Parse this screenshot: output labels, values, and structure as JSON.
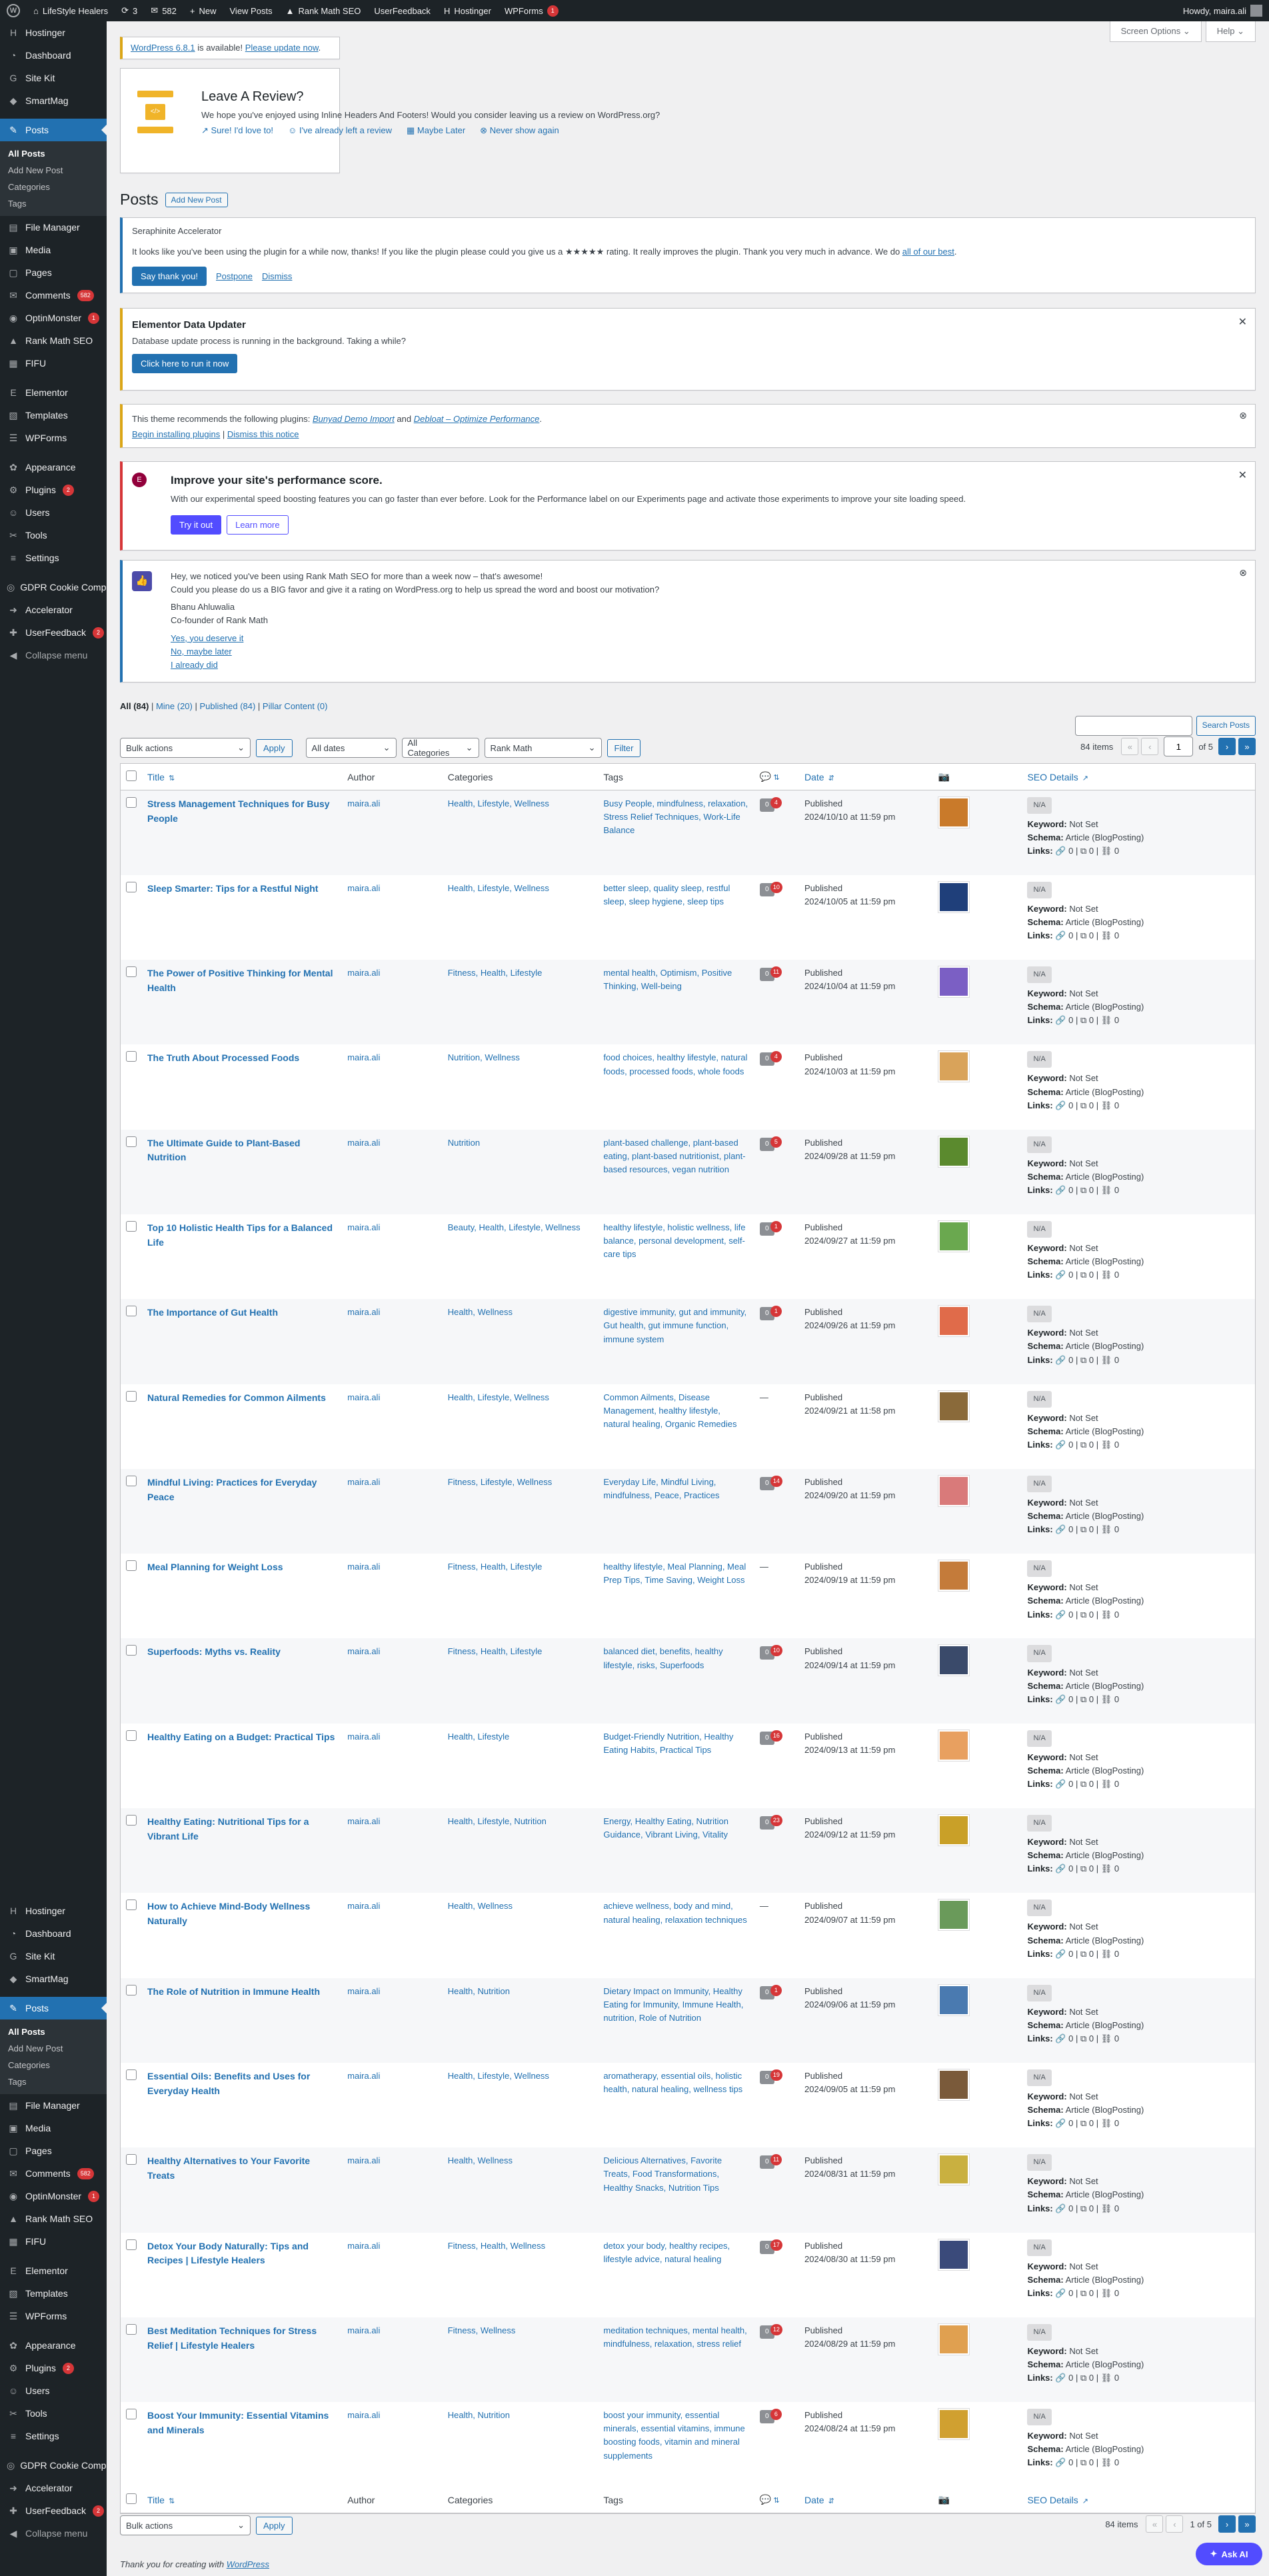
{
  "adminbar": {
    "site": "LifeStyle Healers",
    "updates": "3",
    "comments": "582",
    "new": "New",
    "view": "View Posts",
    "rank": "Rank Math SEO",
    "uf": "UserFeedback",
    "host": "Hostinger",
    "wpforms": "WPForms",
    "wpforms_count": "1",
    "howdy": "Howdy, maira.ali"
  },
  "menu": [
    {
      "id": "hostinger",
      "label": "Hostinger",
      "icon": "H"
    },
    {
      "id": "dashboard",
      "label": "Dashboard",
      "icon": "◔"
    },
    {
      "id": "sitekit",
      "label": "Site Kit",
      "icon": "G"
    },
    {
      "id": "smartmag",
      "label": "SmartMag",
      "icon": "◆"
    },
    {
      "id": "posts",
      "label": "Posts",
      "icon": "✎",
      "active": true
    },
    {
      "id": "filemanager",
      "label": "File Manager",
      "icon": "▤"
    },
    {
      "id": "media",
      "label": "Media",
      "icon": "▣"
    },
    {
      "id": "pages",
      "label": "Pages",
      "icon": "▢"
    },
    {
      "id": "comments",
      "label": "Comments",
      "icon": "✉",
      "badge": "582"
    },
    {
      "id": "optinmonster",
      "label": "OptinMonster",
      "icon": "◉",
      "badge": "1"
    },
    {
      "id": "rankmath",
      "label": "Rank Math SEO",
      "icon": "▲"
    },
    {
      "id": "fifu",
      "label": "FIFU",
      "icon": "▦"
    },
    {
      "id": "elementor",
      "label": "Elementor",
      "icon": "E"
    },
    {
      "id": "templates",
      "label": "Templates",
      "icon": "▧"
    },
    {
      "id": "wpforms",
      "label": "WPForms",
      "icon": "☰"
    },
    {
      "id": "appearance",
      "label": "Appearance",
      "icon": "✿"
    },
    {
      "id": "plugins",
      "label": "Plugins",
      "icon": "⚙",
      "badge": "2"
    },
    {
      "id": "users",
      "label": "Users",
      "icon": "☺"
    },
    {
      "id": "tools",
      "label": "Tools",
      "icon": "✂"
    },
    {
      "id": "settings",
      "label": "Settings",
      "icon": "≡"
    },
    {
      "id": "gdpr",
      "label": "GDPR Cookie Compliance",
      "icon": "◎"
    },
    {
      "id": "accelerator",
      "label": "Accelerator",
      "icon": "➜"
    },
    {
      "id": "userfeedback",
      "label": "UserFeedback",
      "icon": "✚",
      "badge": "2"
    },
    {
      "id": "collapse",
      "label": "Collapse menu",
      "icon": "◀"
    }
  ],
  "submenu": {
    "all": "All Posts",
    "add": "Add New Post",
    "cats": "Categories",
    "tags": "Tags"
  },
  "screen_options": "Screen Options",
  "help": "Help",
  "update": {
    "link1": "WordPress 6.8.1",
    "text": " is available! ",
    "link2": "Please update now",
    "end": "."
  },
  "review": {
    "title": "Leave A Review?",
    "text": "We hope you've enjoyed using Inline Headers And Footers! Would you consider leaving us a review on WordPress.org?",
    "a1": "Sure! I'd love to!",
    "a2": "I've already left a review",
    "a3": "Maybe Later",
    "a4": "Never show again"
  },
  "page_title": "Posts",
  "add_new": "Add New Post",
  "seraph": {
    "title": "Seraphinite Accelerator",
    "text": "It looks like you've been using the plugin for a while now, thanks! If you like the plugin please could you give us a ★★★★★ rating. It really improves the plugin. Thank you very much in advance. We do ",
    "link": "all of our best",
    "end": ".",
    "b1": "Say thank you!",
    "b2": "Postpone",
    "b3": "Dismiss"
  },
  "elem": {
    "title": "Elementor Data Updater",
    "text": "Database update process is running in the background. Taking a while?",
    "btn": "Click here to run it now"
  },
  "theme": {
    "text": "This theme recommends the following plugins: ",
    "p1": "Bunyad Demo Import",
    "and": " and ",
    "p2": "Debloat – Optimize Performance",
    "end": ".",
    "l1": "Begin installing plugins",
    "l2": "Dismiss this notice"
  },
  "perf": {
    "title": "Improve your site's performance score.",
    "text": "With our experimental speed boosting features you can go faster than ever before. Look for the Performance label on our Experiments page and activate those experiments to improve your site loading speed.",
    "b1": "Try it out",
    "b2": "Learn more"
  },
  "rm": {
    "l1": "Hey, we noticed you've been using Rank Math SEO for more than a week now – that's awesome!",
    "l2": "Could you please do us a BIG favor and give it a rating on WordPress.org to help us spread the word and boost our motivation?",
    "name": "Bhanu Ahluwalia",
    "role": "Co-founder of Rank Math",
    "a1": "Yes, you deserve it",
    "a2": "No, maybe later",
    "a3": "I already did"
  },
  "views": {
    "all": "All (84)",
    "mine": "Mine (20)",
    "pub": "Published (84)",
    "pillar": "Pillar Content (0)"
  },
  "search_btn": "Search Posts",
  "filters": {
    "bulk": "Bulk actions",
    "apply": "Apply",
    "dates": "All dates",
    "cats": "All Categories",
    "rank": "Rank Math",
    "filter": "Filter"
  },
  "pagination": {
    "items": "84 items",
    "page": "1",
    "of": "of 5",
    "of2": "1 of 5"
  },
  "columns": {
    "title": "Title",
    "author": "Author",
    "categories": "Categories",
    "tags": "Tags",
    "date": "Date",
    "seo": "SEO Details"
  },
  "seo_labels": {
    "na": "N/A",
    "kw": "Keyword:",
    "kwv": "Not Set",
    "sc": "Schema:",
    "scv": "Article (BlogPosting)",
    "ln": "Links:",
    "lnv": "🔗 0 | ⧉ 0 | ⛓ 0"
  },
  "posts": [
    {
      "title": "Stress Management Techniques for Busy People",
      "author": "maira.ali",
      "cats": "Health, Lifestyle, Wellness",
      "tags": "Busy People, mindfulness, relaxation, Stress Relief Techniques, Work-Life Balance",
      "c": "0",
      "p": "4",
      "status": "Published",
      "date": "2024/10/10 at 11:59 pm",
      "color": "#c97a2a"
    },
    {
      "title": "Sleep Smarter: Tips for a Restful Night",
      "author": "maira.ali",
      "cats": "Health, Lifestyle, Wellness",
      "tags": "better sleep, quality sleep, restful sleep, sleep hygiene, sleep tips",
      "c": "0",
      "p": "10",
      "status": "Published",
      "date": "2024/10/05 at 11:59 pm",
      "color": "#1f3f7a"
    },
    {
      "title": "The Power of Positive Thinking for Mental Health",
      "author": "maira.ali",
      "cats": "Fitness, Health, Lifestyle",
      "tags": "mental health, Optimism, Positive Thinking, Well-being",
      "c": "0",
      "p": "11",
      "status": "Published",
      "date": "2024/10/04 at 11:59 pm",
      "color": "#7b5fc4"
    },
    {
      "title": "The Truth About Processed Foods",
      "author": "maira.ali",
      "cats": "Nutrition, Wellness",
      "tags": "food choices, healthy lifestyle, natural foods, processed foods, whole foods",
      "c": "0",
      "p": "4",
      "status": "Published",
      "date": "2024/10/03 at 11:59 pm",
      "color": "#d9a35a"
    },
    {
      "title": "The Ultimate Guide to Plant-Based Nutrition",
      "author": "maira.ali",
      "cats": "Nutrition",
      "tags": "plant-based challenge, plant-based eating, plant-based nutritionist, plant-based resources, vegan nutrition",
      "c": "0",
      "p": "5",
      "status": "Published",
      "date": "2024/09/28 at 11:59 pm",
      "color": "#5b8a2e"
    },
    {
      "title": "Top 10 Holistic Health Tips for a Balanced Life",
      "author": "maira.ali",
      "cats": "Beauty, Health, Lifestyle, Wellness",
      "tags": "healthy lifestyle, holistic wellness, life balance, personal development, self-care tips",
      "c": "0",
      "p": "1",
      "status": "Published",
      "date": "2024/09/27 at 11:59 pm",
      "color": "#6aa84f"
    },
    {
      "title": "The Importance of Gut Health",
      "author": "maira.ali",
      "cats": "Health, Wellness",
      "tags": "digestive immunity, gut and immunity, Gut health, gut immune function, immune system",
      "c": "0",
      "p": "1",
      "status": "Published",
      "date": "2024/09/26 at 11:59 pm",
      "color": "#e06b4a"
    },
    {
      "title": "Natural Remedies for Common Ailments",
      "author": "maira.ali",
      "cats": "Health, Lifestyle, Wellness",
      "tags": "Common Ailments, Disease Management, healthy lifestyle, natural healing, Organic Remedies",
      "c": "",
      "p": "",
      "status": "Published",
      "date": "2024/09/21 at 11:58 pm",
      "color": "#8a6a3a"
    },
    {
      "title": "Mindful Living: Practices for Everyday Peace",
      "author": "maira.ali",
      "cats": "Fitness, Lifestyle, Wellness",
      "tags": "Everyday Life, Mindful Living, mindfulness, Peace, Practices",
      "c": "0",
      "p": "14",
      "status": "Published",
      "date": "2024/09/20 at 11:59 pm",
      "color": "#d97a7a"
    },
    {
      "title": "Meal Planning for Weight Loss",
      "author": "maira.ali",
      "cats": "Fitness, Health, Lifestyle",
      "tags": "healthy lifestyle, Meal Planning, Meal Prep Tips, Time Saving, Weight Loss",
      "c": "",
      "p": "",
      "status": "Published",
      "date": "2024/09/19 at 11:59 pm",
      "color": "#c47b3a"
    },
    {
      "title": "Superfoods: Myths vs. Reality",
      "author": "maira.ali",
      "cats": "Fitness, Health, Lifestyle",
      "tags": "balanced diet, benefits, healthy lifestyle, risks, Superfoods",
      "c": "0",
      "p": "10",
      "status": "Published",
      "date": "2024/09/14 at 11:59 pm",
      "color": "#3a4a6a"
    },
    {
      "title": "Healthy Eating on a Budget: Practical Tips",
      "author": "maira.ali",
      "cats": "Health, Lifestyle",
      "tags": "Budget-Friendly Nutrition, Healthy Eating Habits, Practical Tips",
      "c": "0",
      "p": "16",
      "status": "Published",
      "date": "2024/09/13 at 11:59 pm",
      "color": "#e8a060"
    },
    {
      "title": "Healthy Eating: Nutritional Tips for a Vibrant Life",
      "author": "maira.ali",
      "cats": "Health, Lifestyle, Nutrition",
      "tags": "Energy, Healthy Eating, Nutrition Guidance, Vibrant Living, Vitality",
      "c": "0",
      "p": "23",
      "status": "Published",
      "date": "2024/09/12 at 11:59 pm",
      "color": "#c9a028"
    },
    {
      "title": "How to Achieve Mind-Body Wellness Naturally",
      "author": "maira.ali",
      "cats": "Health, Wellness",
      "tags": "achieve wellness, body and mind, natural healing, relaxation techniques",
      "c": "",
      "p": "",
      "status": "Published",
      "date": "2024/09/07 at 11:59 pm",
      "color": "#6a9a5a"
    },
    {
      "title": "The Role of Nutrition in Immune Health",
      "author": "maira.ali",
      "cats": "Health, Nutrition",
      "tags": "Dietary Impact on Immunity, Healthy Eating for Immunity, Immune Health, nutrition, Role of Nutrition",
      "c": "0",
      "p": "1",
      "status": "Published",
      "date": "2024/09/06 at 11:59 pm",
      "color": "#4a7ab0"
    },
    {
      "title": "Essential Oils: Benefits and Uses for Everyday Health",
      "author": "maira.ali",
      "cats": "Health, Lifestyle, Wellness",
      "tags": "aromatherapy, essential oils, holistic health, natural healing, wellness tips",
      "c": "0",
      "p": "19",
      "status": "Published",
      "date": "2024/09/05 at 11:59 pm",
      "color": "#7a5a3a"
    },
    {
      "title": "Healthy Alternatives to Your Favorite Treats",
      "author": "maira.ali",
      "cats": "Health, Wellness",
      "tags": "Delicious Alternatives, Favorite Treats, Food Transformations, Healthy Snacks, Nutrition Tips",
      "c": "0",
      "p": "11",
      "status": "Published",
      "date": "2024/08/31 at 11:59 pm",
      "color": "#c9b040"
    },
    {
      "title": "Detox Your Body Naturally: Tips and Recipes | Lifestyle Healers",
      "author": "maira.ali",
      "cats": "Fitness, Health, Wellness",
      "tags": "detox your body, healthy recipes, lifestyle advice, natural healing",
      "c": "0",
      "p": "17",
      "status": "Published",
      "date": "2024/08/30 at 11:59 pm",
      "color": "#3a4a7a"
    },
    {
      "title": "Best Meditation Techniques for Stress Relief | Lifestyle Healers",
      "author": "maira.ali",
      "cats": "Fitness, Wellness",
      "tags": "meditation techniques, mental health, mindfulness, relaxation, stress relief",
      "c": "0",
      "p": "12",
      "status": "Published",
      "date": "2024/08/29 at 11:59 pm",
      "color": "#e0a050"
    },
    {
      "title": "Boost Your Immunity: Essential Vitamins and Minerals",
      "author": "maira.ali",
      "cats": "Health, Nutrition",
      "tags": "boost your immunity, essential minerals, essential vitamins, immune boosting foods, vitamin and mineral supplements",
      "c": "0",
      "p": "6",
      "status": "Published",
      "date": "2024/08/24 at 11:59 pm",
      "color": "#d0a030"
    }
  ],
  "footer": {
    "thanks": "Thank you for creating with ",
    "wp": "WordPress",
    "ask": "Ask AI"
  }
}
